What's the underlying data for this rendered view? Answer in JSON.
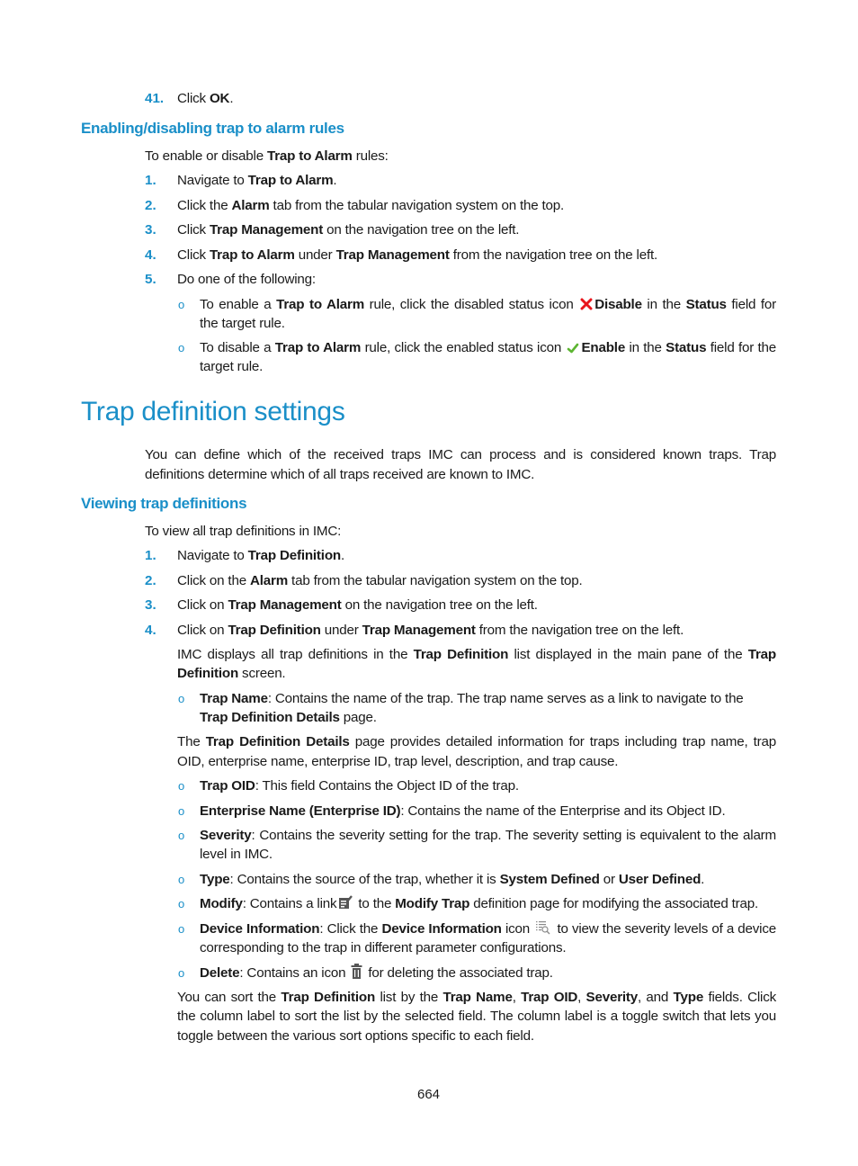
{
  "colors": {
    "accent": "#1a8fc8",
    "disable_icon": "#e8141b",
    "enable_icon": "#5cb531",
    "text": "#1a1a1a"
  },
  "step41": {
    "number": "41.",
    "pre": "Click ",
    "bold": "OK",
    "post": "."
  },
  "section_enable": {
    "heading": "Enabling/disabling trap to alarm rules",
    "intro": {
      "pre": "To enable or disable ",
      "bold": "Trap to Alarm",
      "post": " rules:"
    },
    "steps": [
      {
        "number": "1.",
        "parts": [
          {
            "t": "Navigate to "
          },
          {
            "b": "Trap to Alarm"
          },
          {
            "t": "."
          }
        ]
      },
      {
        "number": "2.",
        "parts": [
          {
            "t": "Click the "
          },
          {
            "b": "Alarm"
          },
          {
            "t": " tab from the tabular navigation system on the top."
          }
        ]
      },
      {
        "number": "3.",
        "parts": [
          {
            "t": "Click "
          },
          {
            "b": "Trap Management"
          },
          {
            "t": " on the navigation tree on the left."
          }
        ]
      },
      {
        "number": "4.",
        "parts": [
          {
            "t": "Click "
          },
          {
            "b": "Trap to Alarm"
          },
          {
            "t": " under "
          },
          {
            "b": "Trap Management"
          },
          {
            "t": " from the navigation tree on the left."
          }
        ]
      },
      {
        "number": "5.",
        "parts": [
          {
            "t": "Do one of the following:"
          }
        ]
      }
    ],
    "bullets": [
      {
        "icon": "disable-x-icon",
        "line1_pre": [
          {
            "t": "To enable a "
          },
          {
            "b": "Trap to Alarm"
          },
          {
            "t": " rule, click the disabled status icon "
          }
        ],
        "icon_label": "Disable",
        "line1_post": [
          {
            "t": " in the "
          },
          {
            "b": "Status"
          },
          {
            "t": " field for"
          }
        ],
        "line2": "the target rule."
      },
      {
        "icon": "enable-check-icon",
        "line1_pre": [
          {
            "t": "To disable a "
          },
          {
            "b": "Trap to Alarm"
          },
          {
            "t": " rule, click the enabled status icon "
          }
        ],
        "icon_label": "Enable",
        "line1_post": [
          {
            "t": " in the "
          },
          {
            "b": "Status"
          },
          {
            "t": " field for the"
          }
        ],
        "line2": "target rule."
      }
    ]
  },
  "section_trapdef": {
    "title": "Trap definition settings",
    "intro_line1": "You can define which of the received traps IMC can process and is considered known traps. Trap",
    "intro_line2": "definitions determine which of all traps received are known to IMC."
  },
  "section_view": {
    "heading": "Viewing trap definitions",
    "intro": "To view all trap definitions in IMC:",
    "steps": [
      {
        "number": "1.",
        "parts": [
          {
            "t": "Navigate to "
          },
          {
            "b": "Trap Definition"
          },
          {
            "t": "."
          }
        ]
      },
      {
        "number": "2.",
        "parts": [
          {
            "t": "Click on the "
          },
          {
            "b": "Alarm"
          },
          {
            "t": " tab from the tabular navigation system on the top."
          }
        ]
      },
      {
        "number": "3.",
        "parts": [
          {
            "t": "Click on "
          },
          {
            "b": "Trap Management"
          },
          {
            "t": " on the navigation tree on the left."
          }
        ]
      },
      {
        "number": "4.",
        "parts": [
          {
            "t": "Click on "
          },
          {
            "b": "Trap Definition"
          },
          {
            "t": " under "
          },
          {
            "b": "Trap Management"
          },
          {
            "t": " from the navigation tree on the left."
          }
        ]
      }
    ],
    "display_para": {
      "line1": [
        {
          "t": "IMC displays all trap definitions in the "
        },
        {
          "b": "Trap Definition"
        },
        {
          "t": " list displayed in the main pane of the "
        },
        {
          "b": "Trap"
        }
      ],
      "line2": [
        {
          "b": "Definition"
        },
        {
          "t": " screen."
        }
      ]
    },
    "trap_name_bullet": {
      "line1": [
        {
          "b": "Trap Name"
        },
        {
          "t": ": Contains the name of the trap. The trap name serves as a link to navigate to the"
        }
      ],
      "line2": [
        {
          "b": "Trap Definition Details"
        },
        {
          "t": " page."
        }
      ]
    },
    "details_para": {
      "line1": [
        {
          "t": "The "
        },
        {
          "b": "Trap Definition Details"
        },
        {
          "t": " page provides detailed information for traps including trap name, trap"
        }
      ],
      "line2": "OID, enterprise name, enterprise ID, trap level, description, and trap cause."
    },
    "field_bullets": [
      {
        "lines": [
          [
            {
              "b": "Trap OID"
            },
            {
              "t": ": This field Contains the Object ID of the trap."
            }
          ]
        ]
      },
      {
        "lines": [
          [
            {
              "b": "Enterprise Name (Enterprise ID)"
            },
            {
              "t": ": Contains the name of the Enterprise and its Object ID."
            }
          ]
        ]
      },
      {
        "lines": [
          [
            {
              "b": "Severity"
            },
            {
              "t": ": Contains the severity setting for the trap. The severity setting is equivalent to the alarm"
            }
          ],
          [
            {
              "t": "level in IMC."
            }
          ]
        ]
      },
      {
        "lines": [
          [
            {
              "b": "Type"
            },
            {
              "t": ": Contains the source of the trap, whether it is "
            },
            {
              "b": "System Defined"
            },
            {
              "t": " or "
            },
            {
              "b": "User Defined"
            },
            {
              "t": "."
            }
          ]
        ]
      }
    ],
    "modify_bullet": {
      "pre": [
        {
          "b": "Modify"
        },
        {
          "t": ": Contains a link"
        }
      ],
      "icon": "modify-edit-icon",
      "post": [
        {
          "t": " to the "
        },
        {
          "b": "Modify Trap"
        },
        {
          "t": " definition page for modifying the associated trap."
        }
      ]
    },
    "device_bullet": {
      "pre": [
        {
          "b": "Device Information"
        },
        {
          "t": ": Click the "
        },
        {
          "b": "Device Information"
        },
        {
          "t": " icon "
        }
      ],
      "icon": "device-info-list-search-icon",
      "post": [
        {
          "t": " to view the severity levels of a device"
        }
      ],
      "line2": "corresponding to the trap in different parameter configurations."
    },
    "delete_bullet": {
      "pre": [
        {
          "b": "Delete"
        },
        {
          "t": ": Contains an icon "
        }
      ],
      "icon": "delete-trash-icon",
      "post": [
        {
          "t": " for deleting the associated trap."
        }
      ]
    },
    "sort_para": {
      "line1": [
        {
          "t": "You can sort the "
        },
        {
          "b": "Trap Definition"
        },
        {
          "t": " list by the "
        },
        {
          "b": "Trap Name"
        },
        {
          "t": ", "
        },
        {
          "b": "Trap OID"
        },
        {
          "t": ", "
        },
        {
          "b": "Severity"
        },
        {
          "t": ", and "
        },
        {
          "b": "Type"
        },
        {
          "t": " fields. Click"
        }
      ],
      "line2": "the column label to sort the list by the selected field. The column label is a toggle switch that lets you",
      "line3": "toggle between the various sort options specific to each field."
    }
  },
  "footer": {
    "page_number": "664"
  }
}
